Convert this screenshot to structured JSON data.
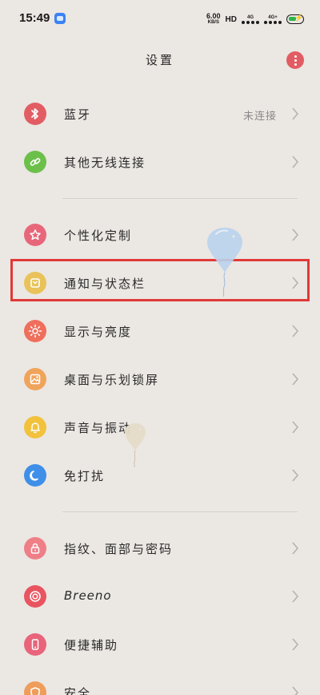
{
  "status_bar": {
    "time": "15:49",
    "net_speed_value": "6.00",
    "net_speed_unit": "KB/S",
    "hd_badge": "HD",
    "sim1_network": "4G",
    "sim2_network": "4G+",
    "battery_color": "#2bb64a"
  },
  "header": {
    "title": "设置",
    "more_icon": "more-vertical-icon",
    "more_color": "#e25d63"
  },
  "settings": [
    {
      "label": "蓝牙",
      "value": "未连接",
      "icon": "bluetooth-icon",
      "icon_color": "#e25d63"
    },
    {
      "label": "其他无线连接",
      "value": "",
      "icon": "link-icon",
      "icon_color": "#6cc04a"
    },
    {
      "label": "个性化定制",
      "value": "",
      "icon": "personalize-icon",
      "icon_color": "#e8667a"
    },
    {
      "label": "通知与状态栏",
      "value": "",
      "icon": "notification-icon",
      "icon_color": "#e9c35a"
    },
    {
      "label": "显示与亮度",
      "value": "",
      "icon": "brightness-icon",
      "icon_color": "#ef6f5c"
    },
    {
      "label": "桌面与乐划锁屏",
      "value": "",
      "icon": "desktop-icon",
      "icon_color": "#f0a45b"
    },
    {
      "label": "声音与振动",
      "value": "",
      "icon": "bell-icon",
      "icon_color": "#f2c23c"
    },
    {
      "label": "免打扰",
      "value": "",
      "icon": "moon-icon",
      "icon_color": "#3f8fe8"
    },
    {
      "label": "指纹、面部与密码",
      "value": "",
      "icon": "lock-icon",
      "icon_color": "#ef7f87"
    },
    {
      "label": "Breeno",
      "value": "",
      "icon": "breeno-icon",
      "icon_color": "#e85560"
    },
    {
      "label": "便捷辅助",
      "value": "",
      "icon": "assist-icon",
      "icon_color": "#e8647a"
    },
    {
      "label": "安全",
      "value": "",
      "icon": "shield-icon",
      "icon_color": "#ef9d5b"
    }
  ]
}
